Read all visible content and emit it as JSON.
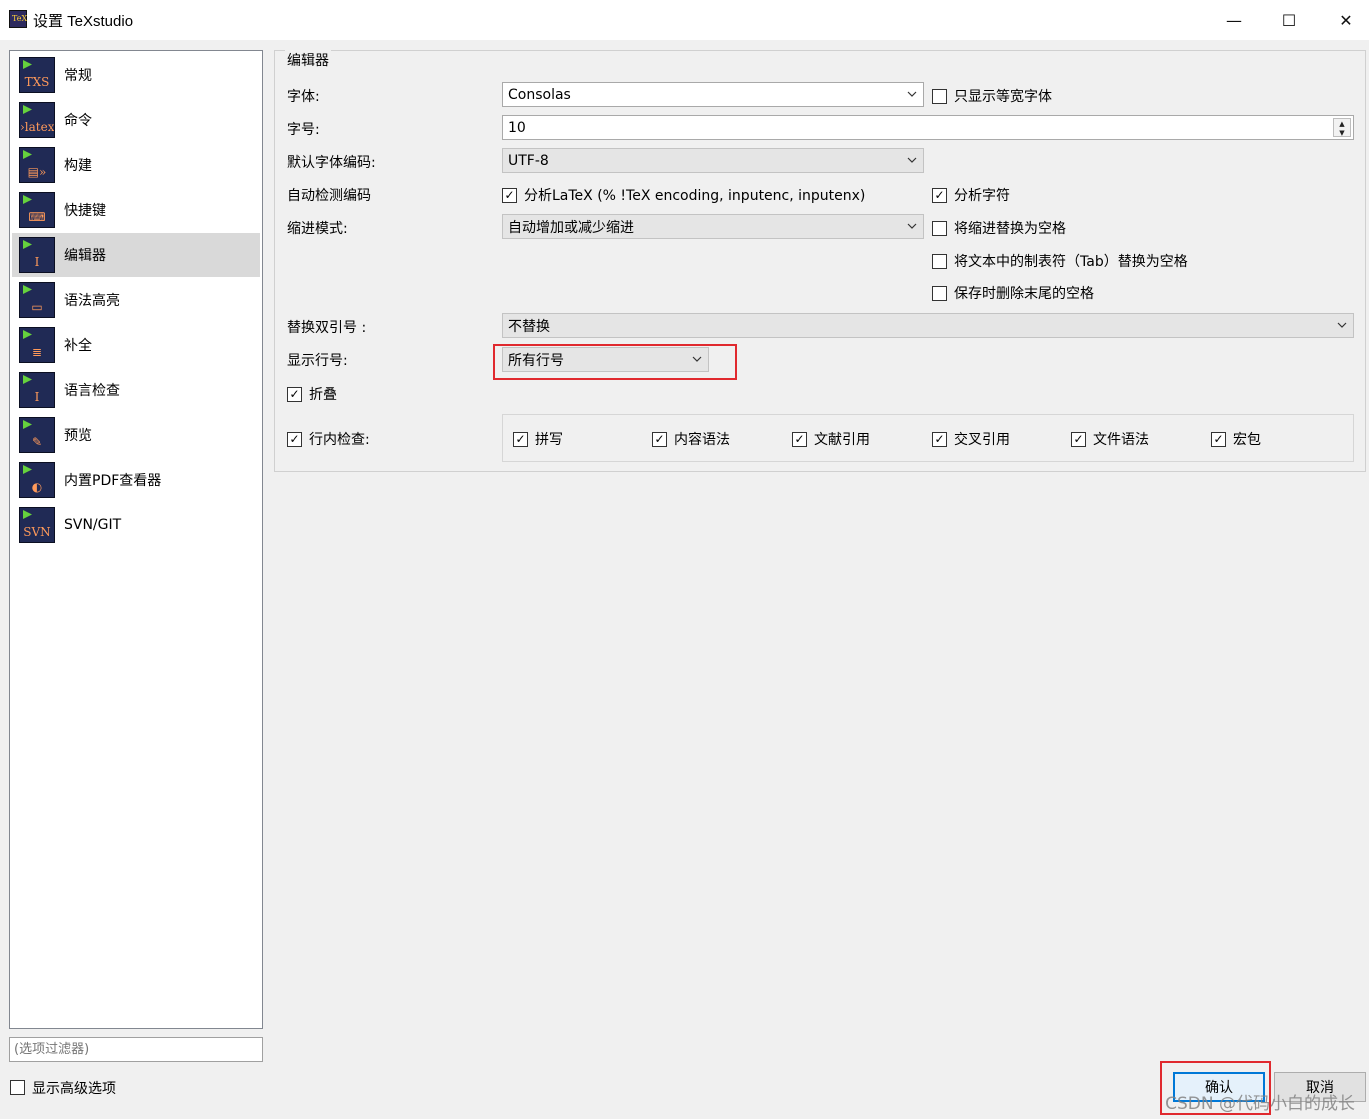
{
  "window": {
    "title": "设置 TeXstudio",
    "app_icon_text": "TeX",
    "minimize": "—",
    "maximize": "☐",
    "close": "✕"
  },
  "sidebar": {
    "items": [
      {
        "label": "常规",
        "icon": "txs-icon",
        "glyph": "TXS"
      },
      {
        "label": "命令",
        "icon": "latex-command-icon",
        "glyph": "›latex"
      },
      {
        "label": "构建",
        "icon": "build-icon",
        "glyph": "▤»"
      },
      {
        "label": "快捷键",
        "icon": "keyboard-icon",
        "glyph": "⌨"
      },
      {
        "label": "编辑器",
        "icon": "editor-cursor-icon",
        "glyph": "I"
      },
      {
        "label": "语法高亮",
        "icon": "syntax-highlight-icon",
        "glyph": "▭"
      },
      {
        "label": "补全",
        "icon": "completion-icon",
        "glyph": "≣"
      },
      {
        "label": "语言检查",
        "icon": "language-check-icon",
        "glyph": "I"
      },
      {
        "label": "预览",
        "icon": "preview-icon",
        "glyph": "✎"
      },
      {
        "label": "内置PDF查看器",
        "icon": "pdf-viewer-icon",
        "glyph": "◐"
      },
      {
        "label": "SVN/GIT",
        "icon": "svn-icon",
        "glyph": "SVN"
      }
    ],
    "selected_index": 4,
    "filter_placeholder": "(选项过滤器)",
    "show_advanced": "显示高级选项"
  },
  "editor": {
    "group_title": "编辑器",
    "font_label": "字体:",
    "font_value": "Consolas",
    "monospace_only": "只显示等宽字体",
    "size_label": "字号:",
    "size_value": "10",
    "encoding_label": "默认字体编码:",
    "encoding_value": "UTF-8",
    "autodetect_label": "自动检测编码",
    "parse_latex": "分析LaTeX (% !TeX encoding, inputenc, inputenx)",
    "parse_chars": "分析字符",
    "indent_label": "缩进模式:",
    "indent_value": "自动增加或减少缩进",
    "replace_indent_tabs": "将缩进替换为空格",
    "replace_text_tabs": "将文本中的制表符（Tab）替换为空格",
    "remove_trailing": "保存时删除末尾的空格",
    "quotes_label": "替换双引号 :",
    "quotes_value": "不替换",
    "line_numbers_label": "显示行号:",
    "line_numbers_value": "所有行号",
    "folding": "折叠",
    "inline_check": "行内检查:",
    "inline_options": [
      "拼写",
      "内容语法",
      "文献引用",
      "交叉引用",
      "文件语法",
      "宏包"
    ]
  },
  "buttons": {
    "ok": "确认",
    "cancel": "取消"
  },
  "watermark": "CSDN @代码小白的成长",
  "colors": {
    "highlight": "#e0292e",
    "selected_item": "#d9d9d9",
    "focus": "#0078d7"
  }
}
